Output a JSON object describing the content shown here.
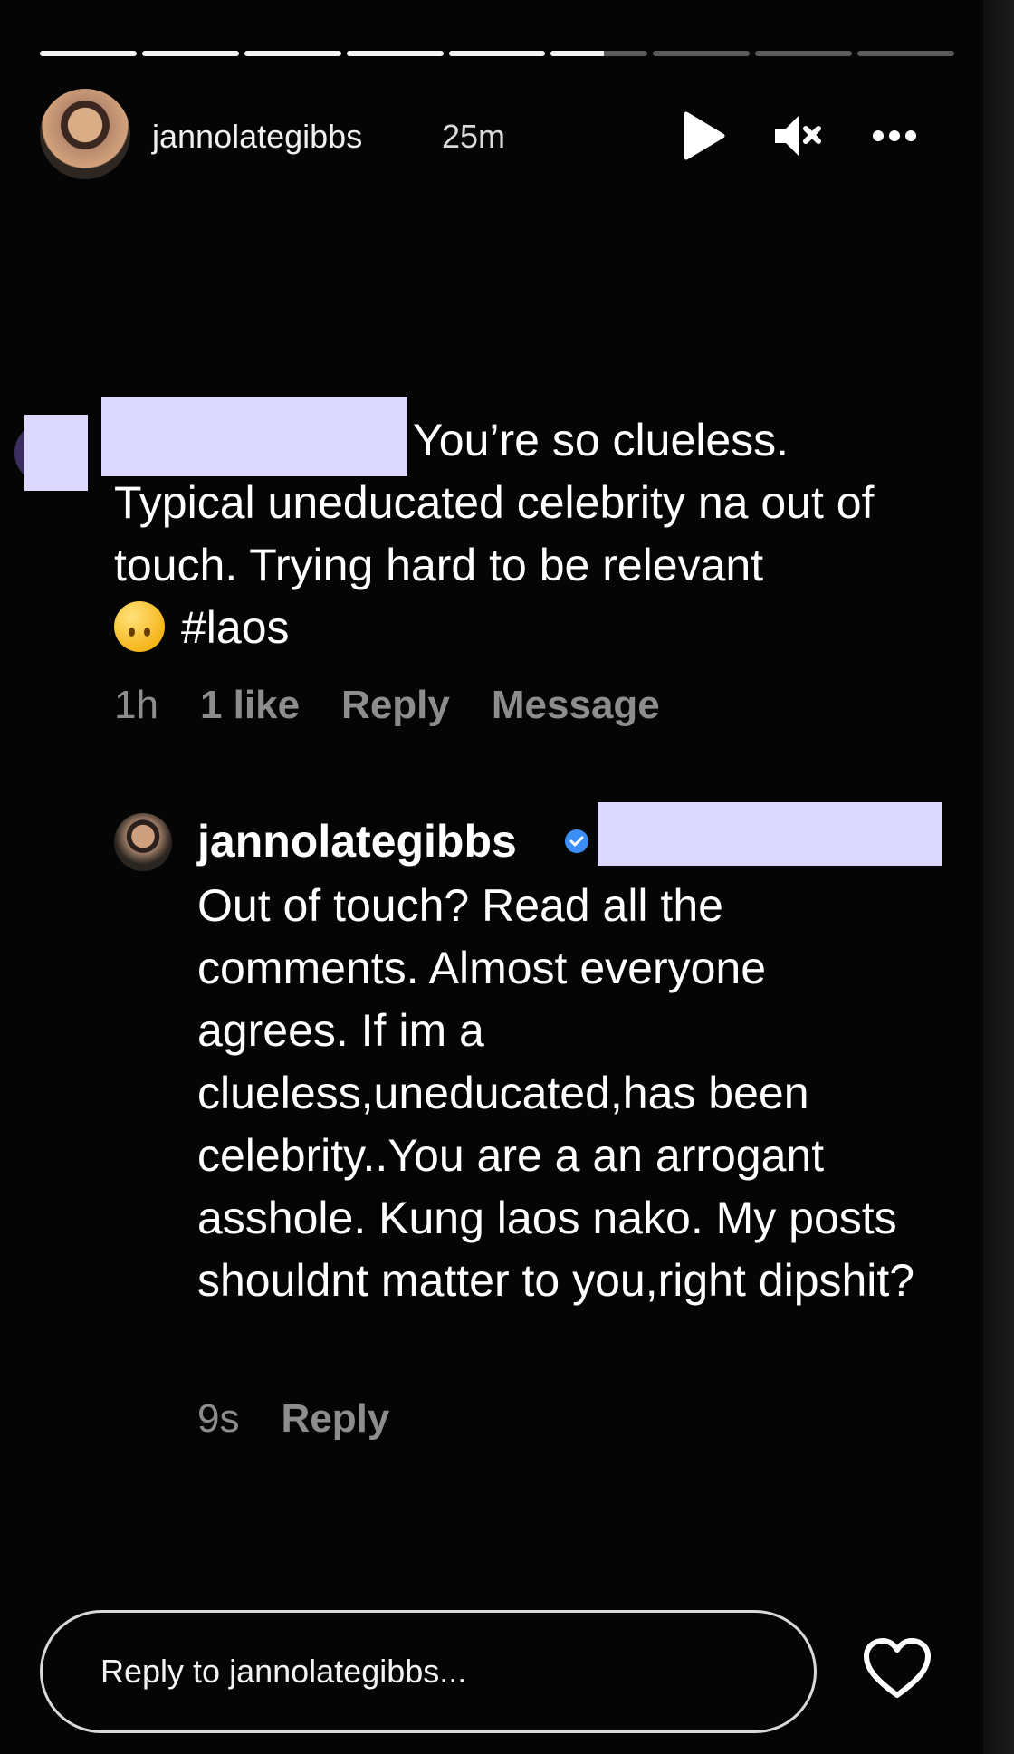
{
  "story": {
    "progress_segments": [
      1,
      1,
      1,
      1,
      1,
      0.55,
      0,
      0,
      0
    ],
    "username": "jannolategibbs",
    "time_ago": "25m"
  },
  "controls": {
    "play_icon": "play-icon",
    "mute_icon": "mute-icon",
    "more_icon": "more-icon"
  },
  "comment": {
    "text": "You’re so clueless. Typical uneducated celebrity na out of touch. Trying hard to be relevant",
    "emoji": "upside-down-face-emoji",
    "hashtag": "#laos",
    "time": "1h",
    "likes": "1 like",
    "reply_label": "Reply",
    "message_label": "Message"
  },
  "reply": {
    "username": "jannolategibbs",
    "text": "Out of touch? Read all the comments. Almost everyone agrees. If im a clueless,uneducated,has been celebrity..You are a an arrogant asshole. Kung laos nako. My posts shouldnt matter to you,right dipshit?",
    "time": "9s",
    "reply_label": "Reply"
  },
  "footer": {
    "reply_placeholder": "Reply to jannolategibbs..."
  }
}
